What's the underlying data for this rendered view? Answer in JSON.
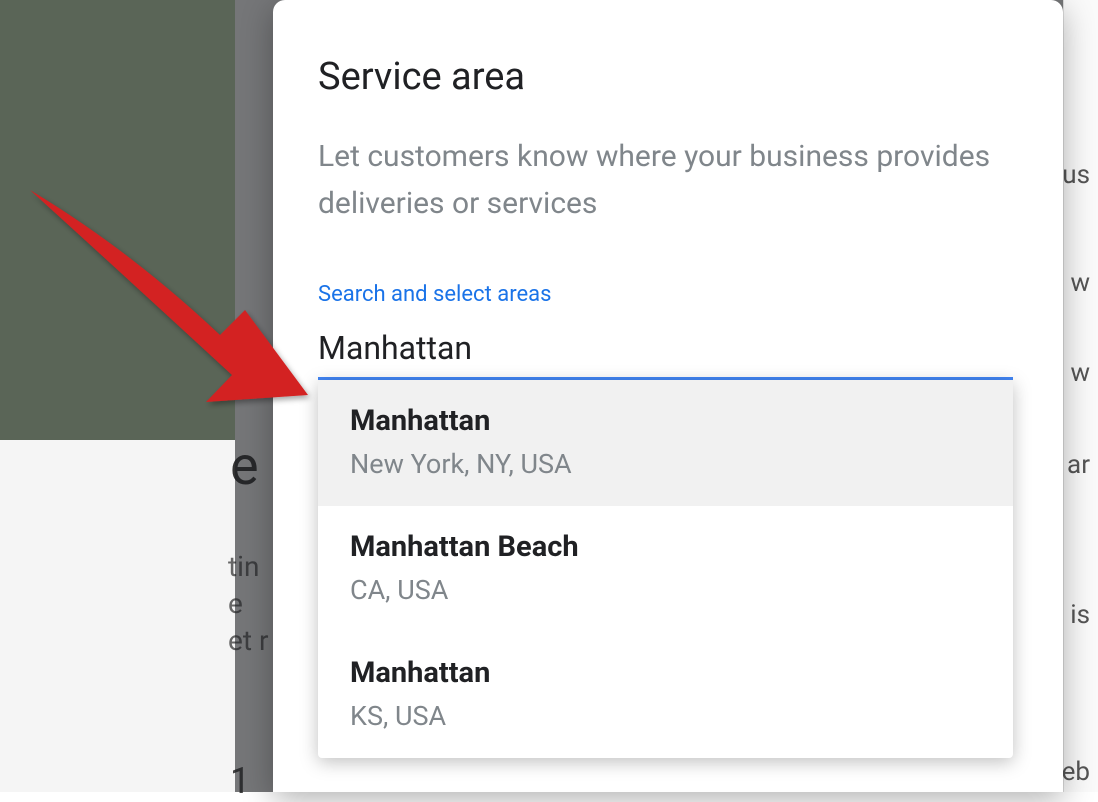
{
  "dialog": {
    "title": "Service area",
    "description": "Let customers know where your business provides deliveries or services",
    "search_label": "Search and select areas",
    "search_value": "Manhattan"
  },
  "suggestions": [
    {
      "title": "Manhattan",
      "subtitle": "New York, NY, USA",
      "highlighted": true
    },
    {
      "title": "Manhattan Beach",
      "subtitle": "CA, USA",
      "highlighted": false
    },
    {
      "title": "Manhattan",
      "subtitle": "KS, USA",
      "highlighted": false
    }
  ],
  "background_fragments": {
    "left_e": "e",
    "tin": "tin",
    "e2": "e",
    "et": "et r",
    "one": "1",
    "r_us": "us",
    "r_w1": "w",
    "r_w2": "w",
    "r_are": "ar",
    "r_is": "is",
    "r_eb": "eb"
  },
  "annotation": {
    "arrow_color": "#d32020"
  }
}
